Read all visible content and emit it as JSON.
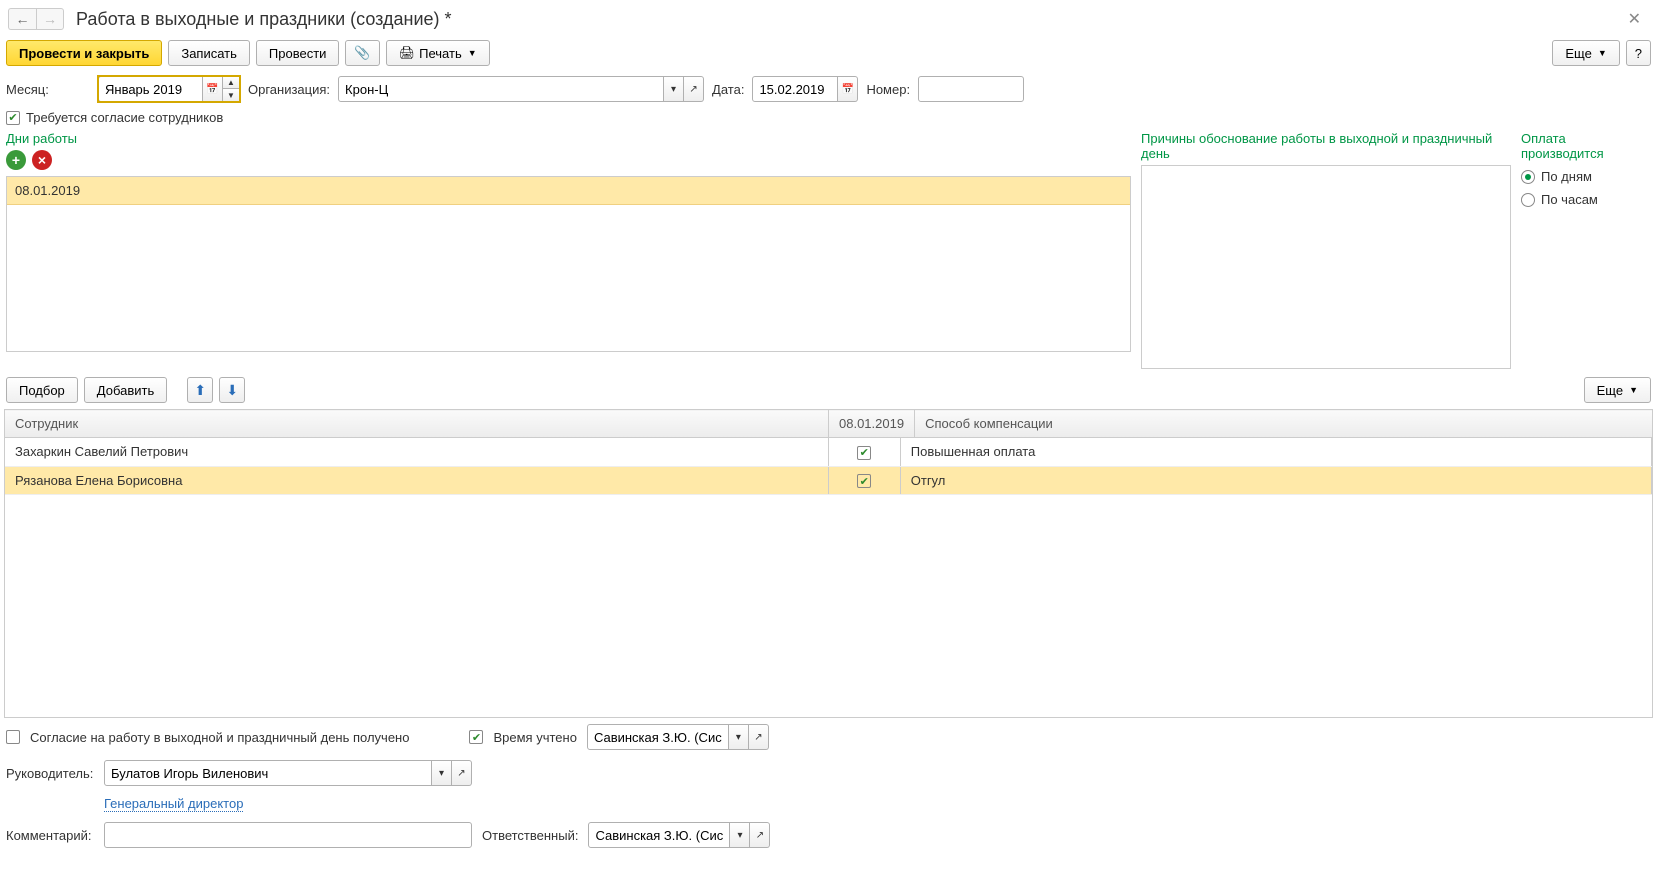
{
  "title": "Работа в выходные и праздники (создание) *",
  "toolbar": {
    "post_close": "Провести и закрыть",
    "save": "Записать",
    "post": "Провести",
    "print": "Печать",
    "more": "Еще",
    "help": "?"
  },
  "fields": {
    "month_label": "Месяц:",
    "month_value": "Январь 2019",
    "org_label": "Организация:",
    "org_value": "Крон-Ц",
    "date_label": "Дата:",
    "date_value": "15.02.2019",
    "number_label": "Номер:",
    "number_value": ""
  },
  "consent_required_label": "Требуется согласие сотрудников",
  "days": {
    "title": "Дни работы",
    "items": [
      "08.01.2019"
    ]
  },
  "reasons_title": "Причины обоснование работы в выходной и праздничный день",
  "payment": {
    "title": "Оплата производится",
    "by_days": "По дням",
    "by_hours": "По часам",
    "selected": "by_days"
  },
  "emp_toolbar": {
    "pick": "Подбор",
    "add": "Добавить",
    "more": "Еще"
  },
  "emp_table": {
    "col_employee": "Сотрудник",
    "col_date": "08.01.2019",
    "col_compensation": "Способ компенсации",
    "rows": [
      {
        "name": "Захаркин Савелий Петрович",
        "checked": true,
        "comp": "Повышенная оплата",
        "selected": false
      },
      {
        "name": "Рязанова Елена Борисовна",
        "checked": true,
        "comp": "Отгул",
        "selected": true
      }
    ]
  },
  "footer": {
    "consent_received": "Согласие на работу в выходной и праздничный день получено",
    "time_counted": "Время учтено",
    "time_person": "Савинская З.Ю. (Системн",
    "manager_label": "Руководитель:",
    "manager_value": "Булатов Игорь Виленович",
    "manager_position": "Генеральный директор",
    "comment_label": "Комментарий:",
    "responsible_label": "Ответственный:",
    "responsible_value": "Савинская З.Ю. (Системн"
  }
}
